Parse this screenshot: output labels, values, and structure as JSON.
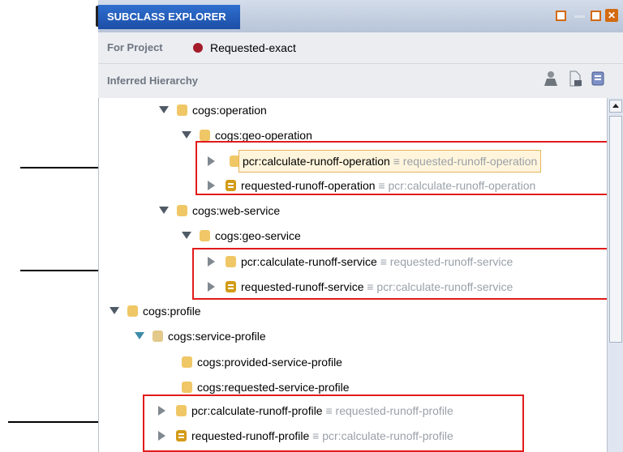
{
  "panel": {
    "title": "SUBCLASS EXPLORER"
  },
  "project": {
    "label": "For Project",
    "name": "Requested-exact"
  },
  "hierarchy": {
    "label": "Inferred Hierarchy"
  },
  "window_buttons": {
    "close": "✕"
  },
  "toolbar_icons": [
    "person-icon",
    "add-class-icon",
    "class-tool-icon"
  ],
  "tree": [
    {
      "label": "cogs:operation",
      "equivalent": ""
    },
    {
      "label": "cogs:geo-operation",
      "equivalent": ""
    },
    {
      "label": "pcr:calculate-runoff-operation",
      "equivalent": "≡ requested-runoff-operation"
    },
    {
      "label": "requested-runoff-operation",
      "equivalent": "≡ pcr:calculate-runoff-operation"
    },
    {
      "label": "cogs:web-service",
      "equivalent": ""
    },
    {
      "label": "cogs:geo-service",
      "equivalent": ""
    },
    {
      "label": "pcr:calculate-runoff-service",
      "equivalent": "≡ requested-runoff-service"
    },
    {
      "label": "requested-runoff-service",
      "equivalent": "≡ pcr:calculate-runoff-service"
    },
    {
      "label": "cogs:profile",
      "equivalent": ""
    },
    {
      "label": "cogs:service-profile",
      "equivalent": ""
    },
    {
      "label": "cogs:provided-service-profile",
      "equivalent": ""
    },
    {
      "label": "cogs:requested-service-profile",
      "equivalent": ""
    },
    {
      "label": "pcr:calculate-runoff-profile",
      "equivalent": "≡ requested-runoff-profile"
    },
    {
      "label": "requested-runoff-profile",
      "equivalent": "≡ pcr:calculate-runoff-profile"
    }
  ],
  "colors": {
    "title_bg": "#1c4ea6",
    "highlight_box": "#e11b1b",
    "class_icon": "#f0c766",
    "defined_class_icon": "#d39b16"
  }
}
